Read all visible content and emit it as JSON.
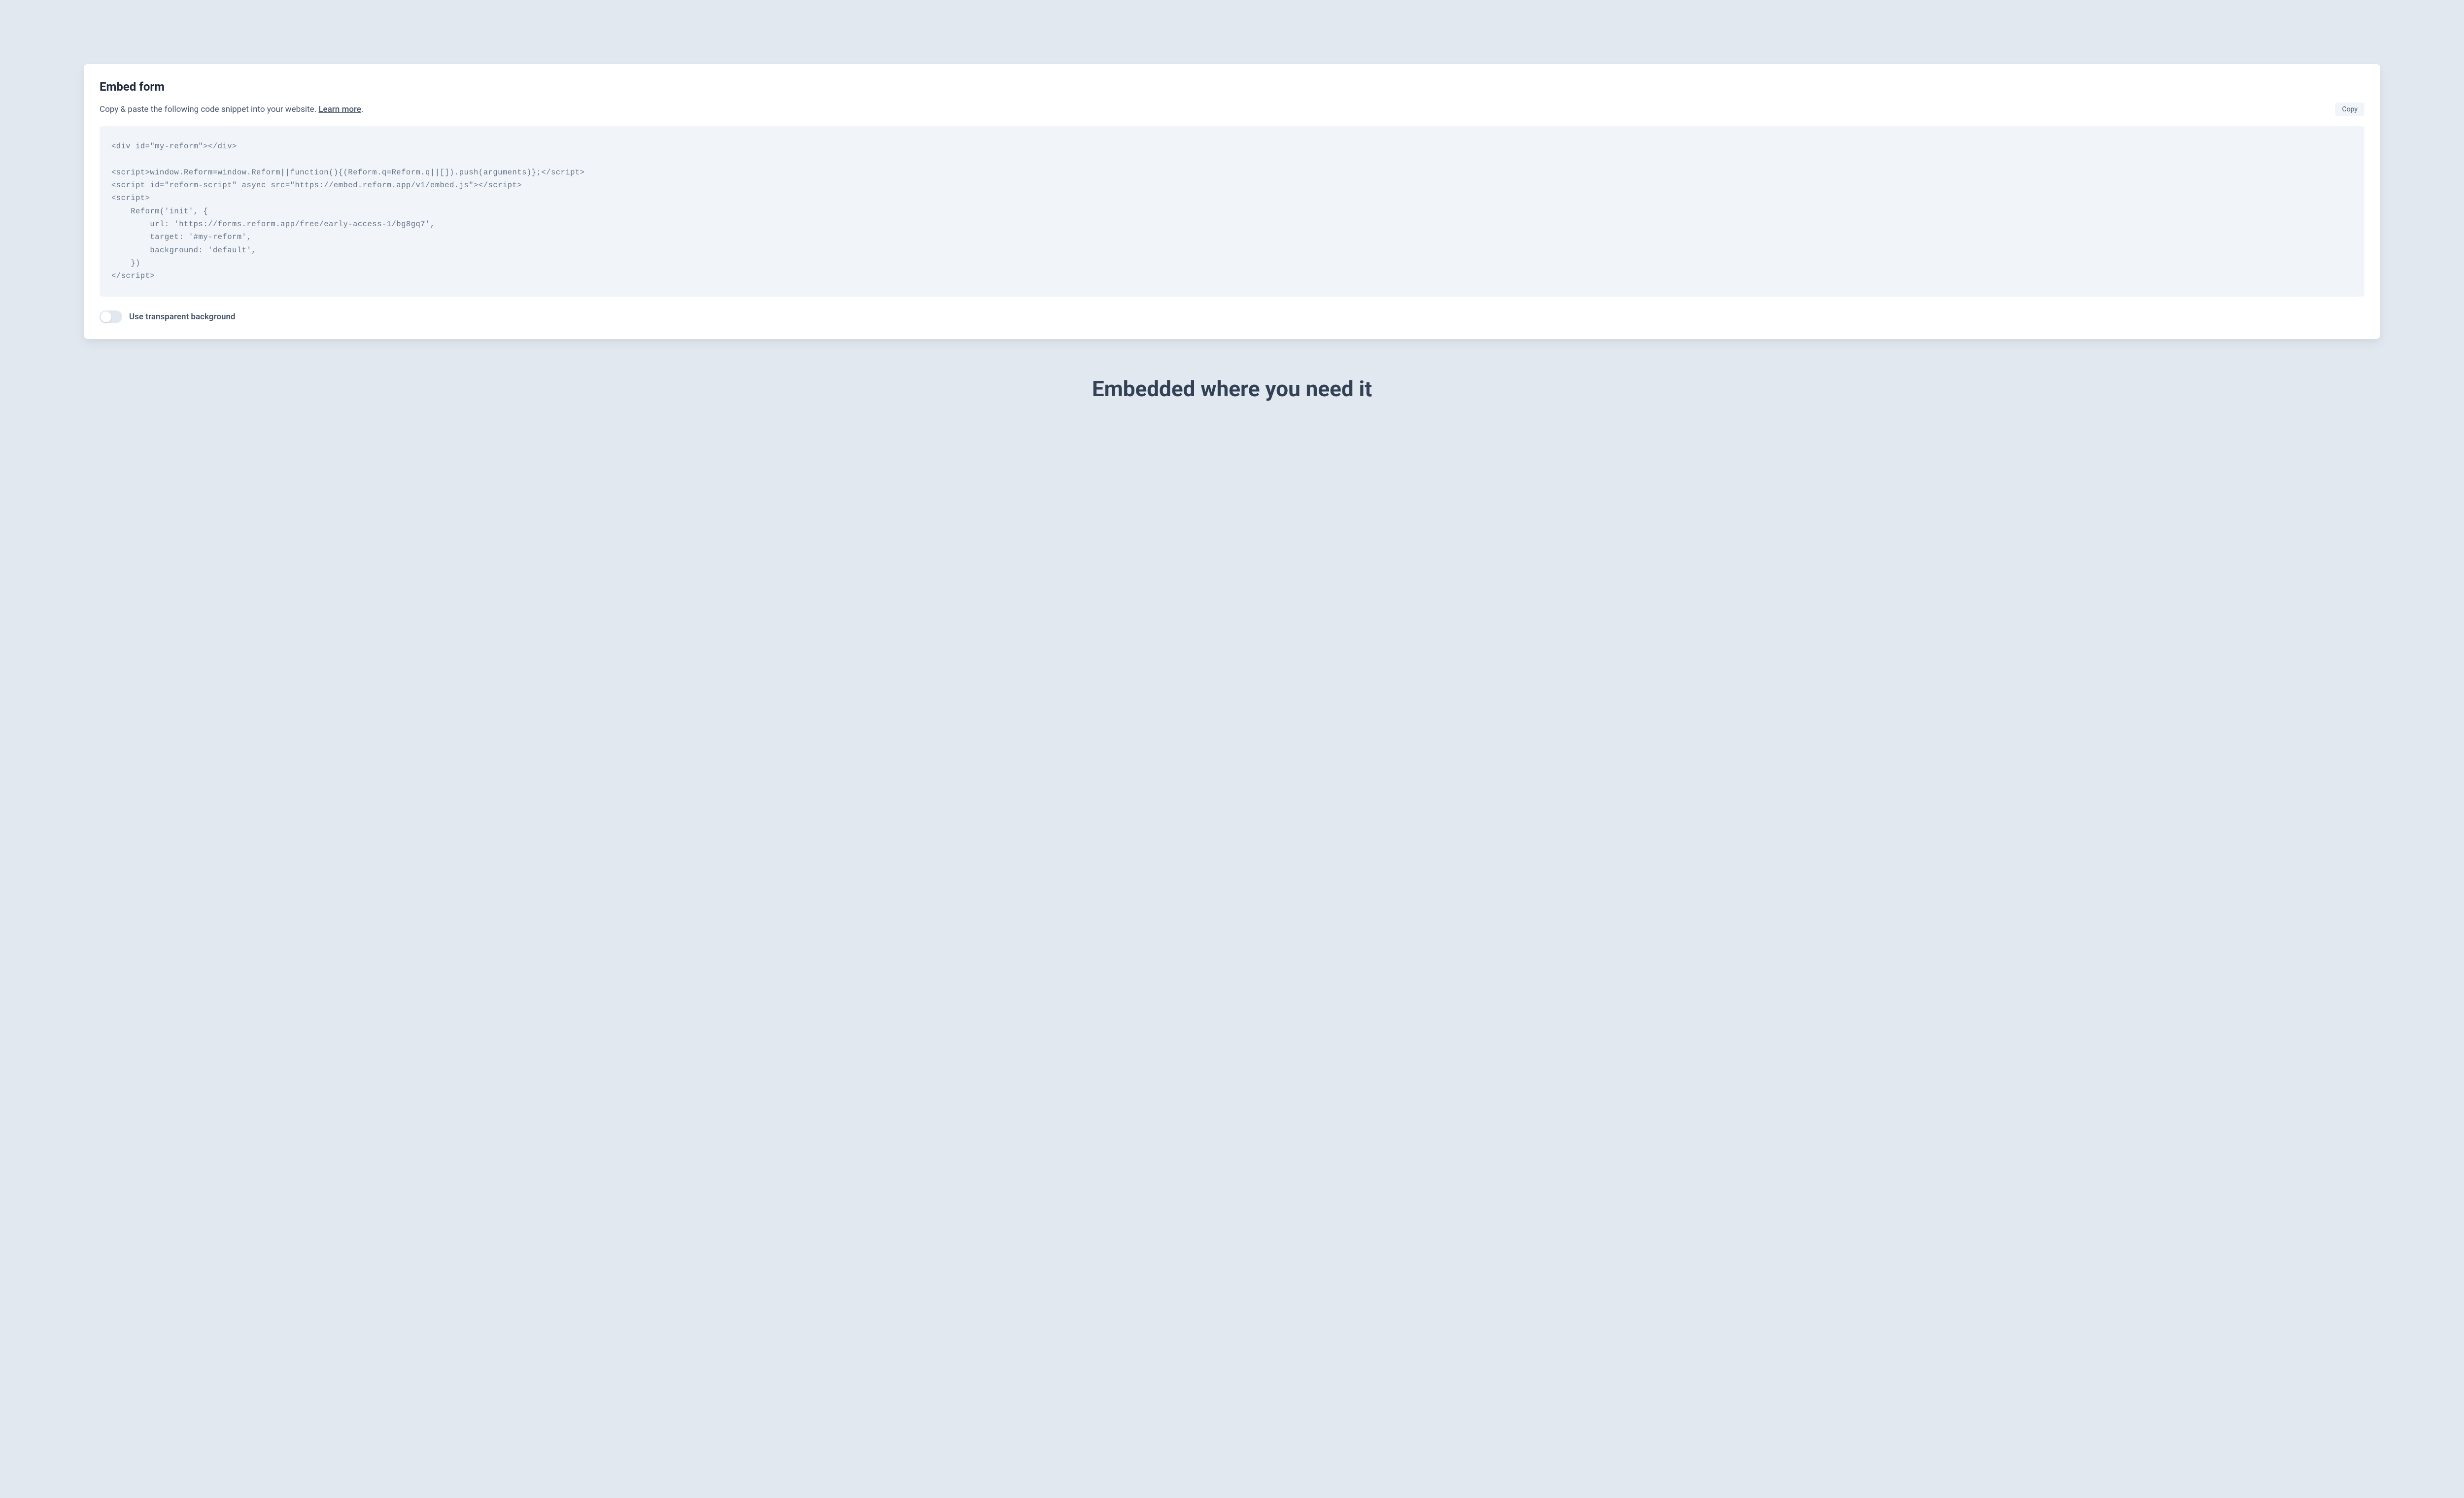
{
  "card": {
    "title": "Embed form",
    "description_prefix": "Copy & paste the following code snippet into your website. ",
    "learn_more": "Learn more",
    "description_suffix": ".",
    "copy_button": "Copy",
    "code": "<div id=\"my-reform\"></div>\n\n<script>window.Reform=window.Reform||function(){(Reform.q=Reform.q||[]).push(arguments)};</script>\n<script id=\"reform-script\" async src=\"https://embed.reform.app/v1/embed.js\"></script>\n<script>\n    Reform('init', {\n        url: 'https://forms.reform.app/free/early-access-1/bg8gq7',\n        target: '#my-reform',\n        background: 'default',\n    })\n</script>",
    "toggle_label": "Use transparent background"
  },
  "headline": "Embedded where you need it"
}
